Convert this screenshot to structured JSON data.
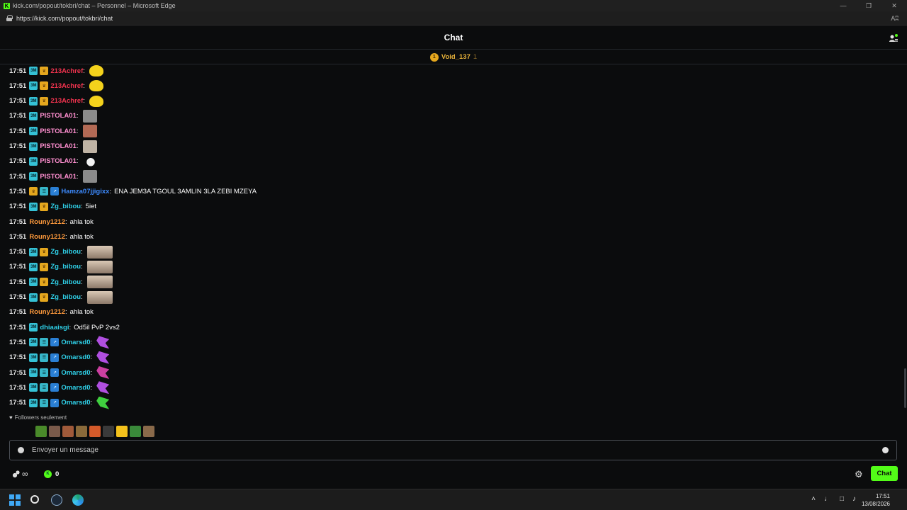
{
  "browser": {
    "window_title": "kick.com/popout/tokbri/chat – Personnel – Microsoft Edge",
    "url": "https://kick.com/popout/tokbri/chat",
    "read_aloud": "Aʭ"
  },
  "window_controls": {
    "minimize": "—",
    "restore": "❐",
    "close": "✕"
  },
  "header": {
    "title": "Chat"
  },
  "pinned": {
    "username": "Void_137",
    "count": "1",
    "badge": "1"
  },
  "colors": {
    "accent": "#53fc18",
    "gold": "#e8b23a"
  },
  "messages": [
    {
      "time": "17:51",
      "badges": [
        "sub",
        "crown"
      ],
      "user": "213Achref",
      "color": "#f0334e",
      "text": "",
      "emote": "yellow"
    },
    {
      "time": "17:51",
      "badges": [
        "sub",
        "crown"
      ],
      "user": "213Achref",
      "color": "#f0334e",
      "text": "",
      "emote": "yellow"
    },
    {
      "time": "17:51",
      "badges": [
        "sub",
        "crown"
      ],
      "user": "213Achref",
      "color": "#f0334e",
      "text": "",
      "emote": "yellow"
    },
    {
      "time": "17:51",
      "badges": [
        "sub"
      ],
      "user": "PISTOLA01",
      "color": "#ff8fd0",
      "text": "",
      "emote": "face"
    },
    {
      "time": "17:51",
      "badges": [
        "sub"
      ],
      "user": "PISTOLA01",
      "color": "#ff8fd0",
      "text": "",
      "emote": "face-red"
    },
    {
      "time": "17:51",
      "badges": [
        "sub"
      ],
      "user": "PISTOLA01",
      "color": "#ff8fd0",
      "text": "",
      "emote": "face-light"
    },
    {
      "time": "17:51",
      "badges": [
        "sub"
      ],
      "user": "PISTOLA01",
      "color": "#ff8fd0",
      "text": "",
      "emote": "duck"
    },
    {
      "time": "17:51",
      "badges": [
        "sub"
      ],
      "user": "PISTOLA01",
      "color": "#ff8fd0",
      "text": "",
      "emote": "face"
    },
    {
      "time": "17:51",
      "badges": [
        "crown",
        "og",
        "vip"
      ],
      "user": "Hamza07jjigixx",
      "color": "#3d8bff",
      "text": "ENA JEM3A TGOUL 3AMLIN 3LA ZEBI MZEYA",
      "emote": ""
    },
    {
      "time": "17:51",
      "badges": [
        "sub",
        "crown"
      ],
      "user": "Zg_bibou",
      "color": "#2fd0e8",
      "text": "5iet",
      "emote": ""
    },
    {
      "time": "17:51",
      "badges": [],
      "user": "Rouny1212",
      "color": "#ff9a3c",
      "text": "ahla tok",
      "emote": ""
    },
    {
      "time": "17:51",
      "badges": [],
      "user": "Rouny1212",
      "color": "#ff9a3c",
      "text": "ahla tok",
      "emote": ""
    },
    {
      "time": "17:51",
      "badges": [
        "sub",
        "crown"
      ],
      "user": "Zg_bibou",
      "color": "#2fd0e8",
      "text": "",
      "emote": "coffee"
    },
    {
      "time": "17:51",
      "badges": [
        "sub",
        "crown"
      ],
      "user": "Zg_bibou",
      "color": "#2fd0e8",
      "text": "",
      "emote": "coffee"
    },
    {
      "time": "17:51",
      "badges": [
        "sub",
        "crown"
      ],
      "user": "Zg_bibou",
      "color": "#2fd0e8",
      "text": "",
      "emote": "coffee"
    },
    {
      "time": "17:51",
      "badges": [
        "sub",
        "crown"
      ],
      "user": "Zg_bibou",
      "color": "#2fd0e8",
      "text": "",
      "emote": "coffee"
    },
    {
      "time": "17:51",
      "badges": [],
      "user": "Rouny1212",
      "color": "#ff9a3c",
      "text": "ahla tok",
      "emote": ""
    },
    {
      "time": "17:51",
      "badges": [
        "sub"
      ],
      "user": "dhiaaisgi",
      "color": "#2fd0e8",
      "text": "Od5il PvP 2vs2",
      "emote": ""
    },
    {
      "time": "17:51",
      "badges": [
        "sub",
        "og",
        "vip"
      ],
      "user": "Omarsd0",
      "color": "#2fd0e8",
      "text": "",
      "emote": "purple"
    },
    {
      "time": "17:51",
      "badges": [
        "sub",
        "og",
        "vip"
      ],
      "user": "Omarsd0",
      "color": "#2fd0e8",
      "text": "",
      "emote": "purple"
    },
    {
      "time": "17:51",
      "badges": [
        "sub",
        "og",
        "vip"
      ],
      "user": "Omarsd0",
      "color": "#2fd0e8",
      "text": "",
      "emote": "pink"
    },
    {
      "time": "17:51",
      "badges": [
        "sub",
        "og",
        "vip"
      ],
      "user": "Omarsd0",
      "color": "#2fd0e8",
      "text": "",
      "emote": "purple"
    },
    {
      "time": "17:51",
      "badges": [
        "sub",
        "og",
        "vip"
      ],
      "user": "Omarsd0",
      "color": "#2fd0e8",
      "text": "",
      "emote": "green"
    }
  ],
  "followers_only": "Followers seulement",
  "emote_strip": [
    "#4a8a2a",
    "#7a5a4a",
    "#a05a3a",
    "#8a6a3a",
    "#d45a2a",
    "#3a3a3a",
    "#f4c21c",
    "#3a8a3a",
    "#8a6a4a"
  ],
  "input": {
    "placeholder": "Envoyer un message"
  },
  "footer": {
    "infinity": "∞",
    "points": "0",
    "chat_button": "Chat",
    "gear": "⚙"
  },
  "taskbar": {
    "tray": [
      "˄",
      "♩",
      "□",
      "♪"
    ],
    "time": "17:51",
    "date": "13/08/2026"
  }
}
